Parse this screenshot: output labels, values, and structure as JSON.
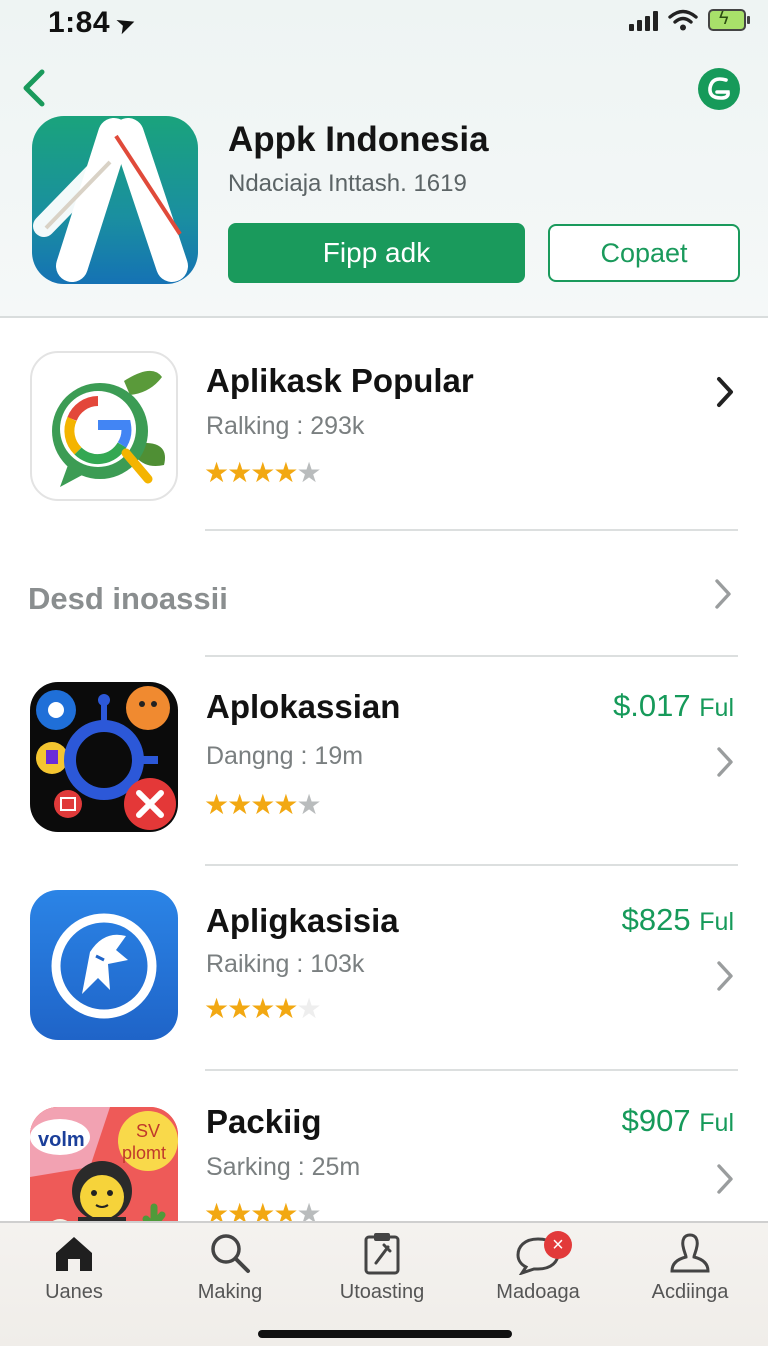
{
  "status": {
    "time": "1:84",
    "location_icon": "location-arrow-icon"
  },
  "header": {
    "back_icon": "chevron-left-icon",
    "share_icon": "share-circle-icon",
    "app_title": "Appk Indonesia",
    "app_subtitle": "Ndaciaja Inttash. 1619",
    "primary_button": "Fipp adk",
    "secondary_button": "Copaet"
  },
  "featured": {
    "name": "Aplikask Popular",
    "meta": "Ralking : 293k",
    "rating": 4
  },
  "section": {
    "title": "Desd inoassii"
  },
  "apps": [
    {
      "name": "Aplokassian",
      "meta": "Dangng : 19m",
      "price": "$.017",
      "price_suffix": "Ful",
      "rating": 4
    },
    {
      "name": "Apligkasisia",
      "meta": "Raiking : 103k",
      "price": "$825",
      "price_suffix": "Ful",
      "rating": 4
    },
    {
      "name": "Packiig",
      "meta": "Sarking : 25m",
      "price": "$907",
      "price_suffix": "Ful",
      "rating": 4
    }
  ],
  "icon_text": {
    "volm": "volm",
    "sv": "SV",
    "plomt": "plomt"
  },
  "tabs": [
    {
      "label": "Uanes",
      "icon": "home-icon"
    },
    {
      "label": "Making",
      "icon": "search-icon"
    },
    {
      "label": "Utoasting",
      "icon": "clipboard-icon"
    },
    {
      "label": "Madoaga",
      "icon": "chat-bubble-icon",
      "badge": "×"
    },
    {
      "label": "Acdiinga",
      "icon": "person-icon"
    }
  ],
  "colors": {
    "accent": "#1a9a5c",
    "star": "#f2a812",
    "badge": "#e23a3a"
  }
}
